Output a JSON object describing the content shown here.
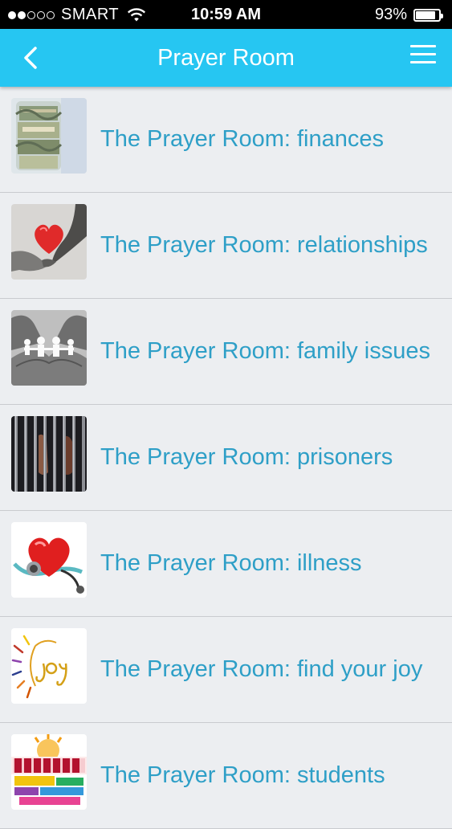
{
  "status_bar": {
    "carrier": "SMART",
    "time": "10:59 AM",
    "battery": "93%",
    "battery_level": 0.93,
    "signal_bars": 2,
    "signal_total": 5
  },
  "nav": {
    "title": "Prayer Room",
    "back_icon": "chevron-left-icon",
    "menu_icon": "hamburger-menu-icon",
    "background_color": "#26c6f2"
  },
  "list": {
    "link_color": "#2e9fc7",
    "items": [
      {
        "label": "The Prayer Room: finances",
        "icon": "money-jar-thumbnail"
      },
      {
        "label": "The Prayer Room: relationships",
        "icon": "holding-hands-heart-thumbnail"
      },
      {
        "label": "The Prayer Room: family issues",
        "icon": "paper-family-hands-thumbnail"
      },
      {
        "label": "The Prayer Room: prisoners",
        "icon": "prison-bars-thumbnail"
      },
      {
        "label": "The Prayer Room: illness",
        "icon": "heart-stethoscope-thumbnail"
      },
      {
        "label": "The Prayer Room: find your joy",
        "icon": "joy-sun-thumbnail"
      },
      {
        "label": "The Prayer Room: students",
        "icon": "students-text-thumbnail"
      }
    ]
  }
}
